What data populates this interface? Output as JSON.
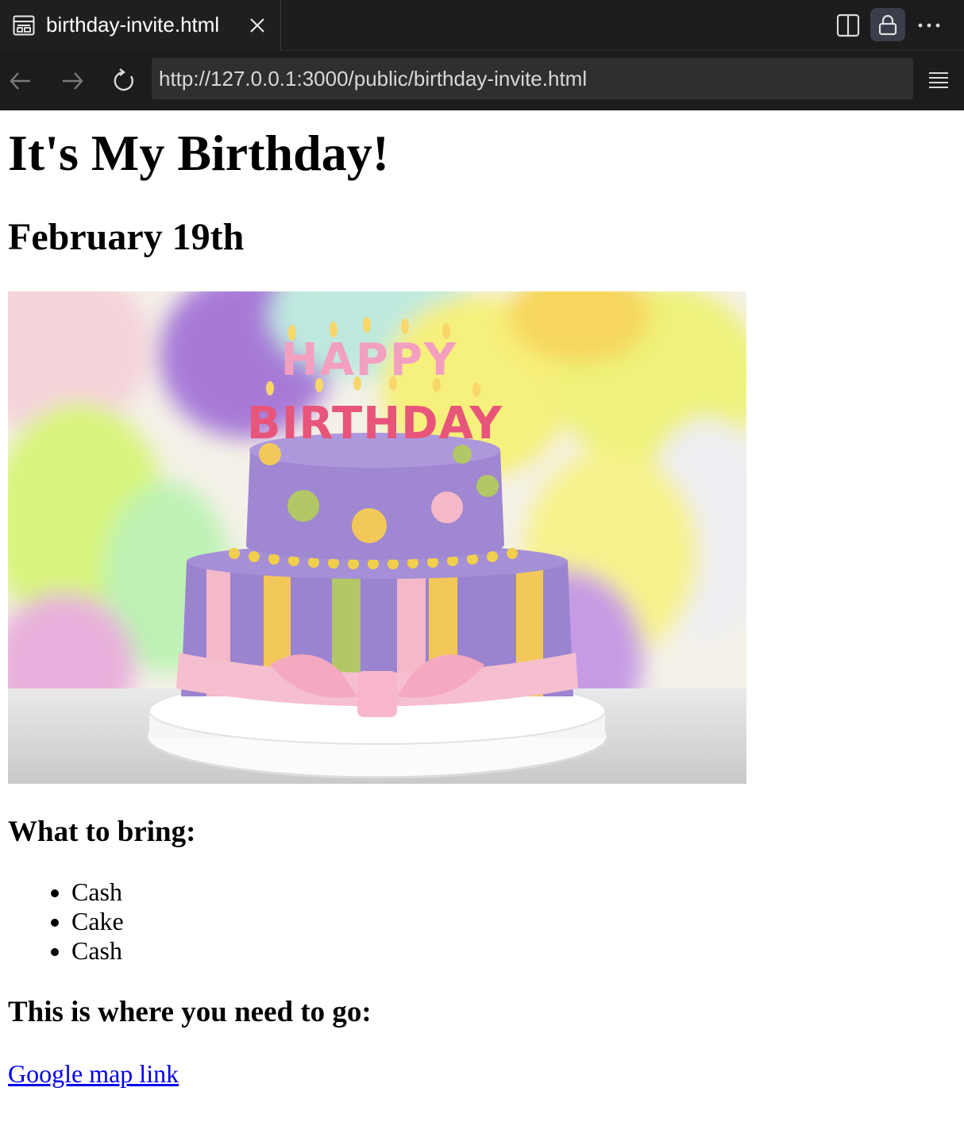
{
  "browser": {
    "tab": {
      "title": "birthday-invite.html",
      "icon": "page-layout-icon"
    },
    "toolbar_icons": [
      "split-view-icon",
      "lock-icon",
      "more-icon"
    ],
    "nav_icons": [
      "back-arrow-icon",
      "forward-arrow-icon",
      "reload-icon",
      "menu-icon"
    ],
    "url": "http://127.0.0.1:3000/public/birthday-invite.html"
  },
  "page": {
    "heading": "It's My Birthday!",
    "date": "February 19th",
    "image_text": {
      "top": "HAPPY",
      "bottom": "BIRTHDAY"
    },
    "bring_heading": "What to bring:",
    "bring_items": [
      "Cash",
      "Cake",
      "Cash"
    ],
    "location_heading": "This is where you need to go:",
    "map_link": "Google map link"
  },
  "colors": {
    "chrome_bg": "#1c1c1c",
    "urlbar_bg": "#2f2f2f",
    "link": "#0000ee",
    "cake_purple": "#9b84cf",
    "cake_pink": "#f4b8c9",
    "cake_yellow": "#f3c85a",
    "cake_green": "#b2c766"
  }
}
